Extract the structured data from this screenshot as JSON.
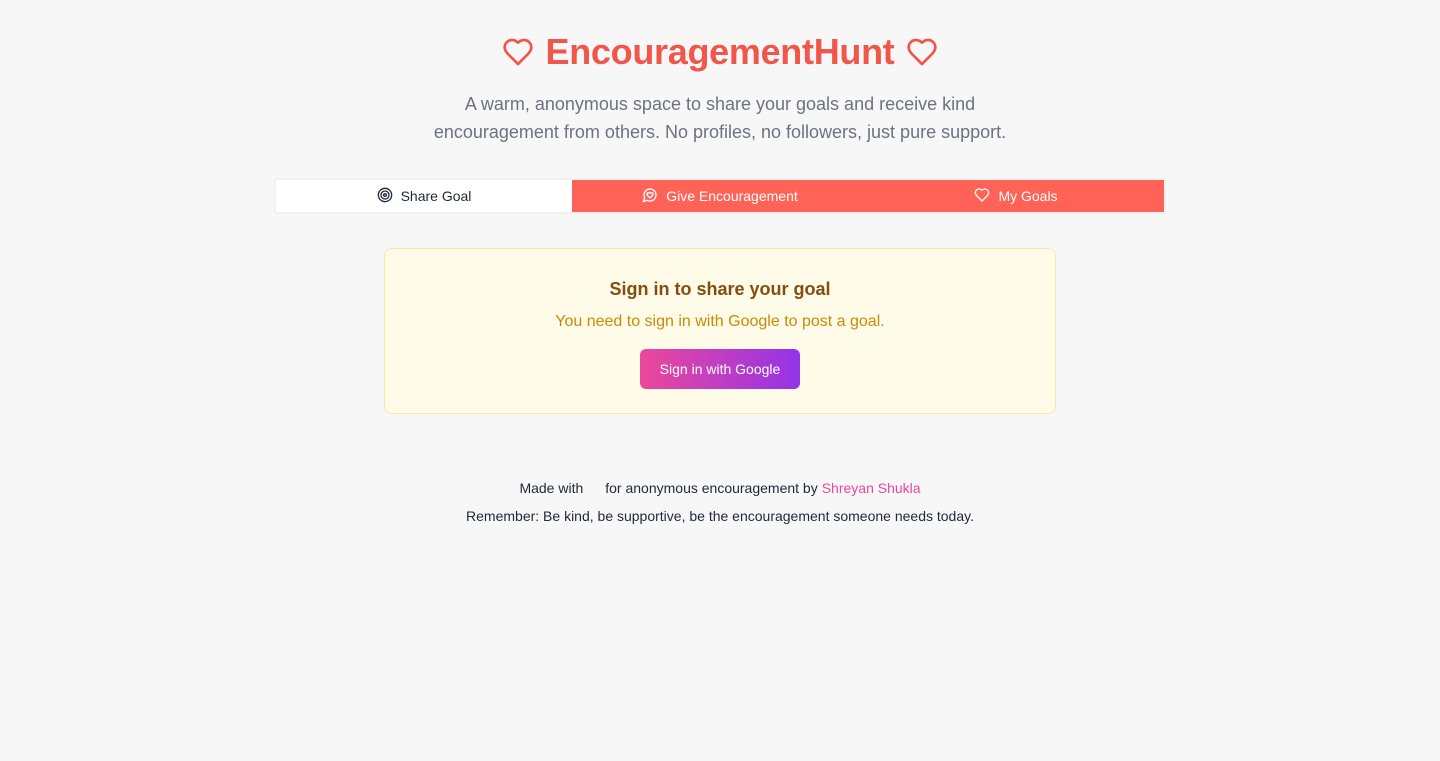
{
  "header": {
    "title": "EncouragementHunt",
    "subtitle": "A warm, anonymous space to share your goals and receive kind encouragement from others. No profiles, no followers, just pure support.",
    "title_color": "#f0564a",
    "left_icon": "heart-icon",
    "right_icon": "heart-icon"
  },
  "tabs": [
    {
      "label": "Share Goal",
      "icon": "target-icon",
      "active": true
    },
    {
      "label": "Give Encouragement",
      "icon": "message-heart-icon",
      "active": false
    },
    {
      "label": "My Goals",
      "icon": "heart-icon",
      "active": false
    }
  ],
  "signin_card": {
    "title": "Sign in to share your goal",
    "message": "You need to sign in with Google to post a goal.",
    "button_label": "Sign in with Google"
  },
  "footer": {
    "made_with": "Made with",
    "for_text": "for anonymous encouragement by",
    "author": "Shreyan Shukla",
    "reminder": "Remember: Be kind, be supportive, be the encouragement someone needs today."
  },
  "colors": {
    "accent": "#ff6358",
    "background": "#f7f7f7",
    "card_background": "#fefbe8",
    "link": "#ec4899"
  }
}
